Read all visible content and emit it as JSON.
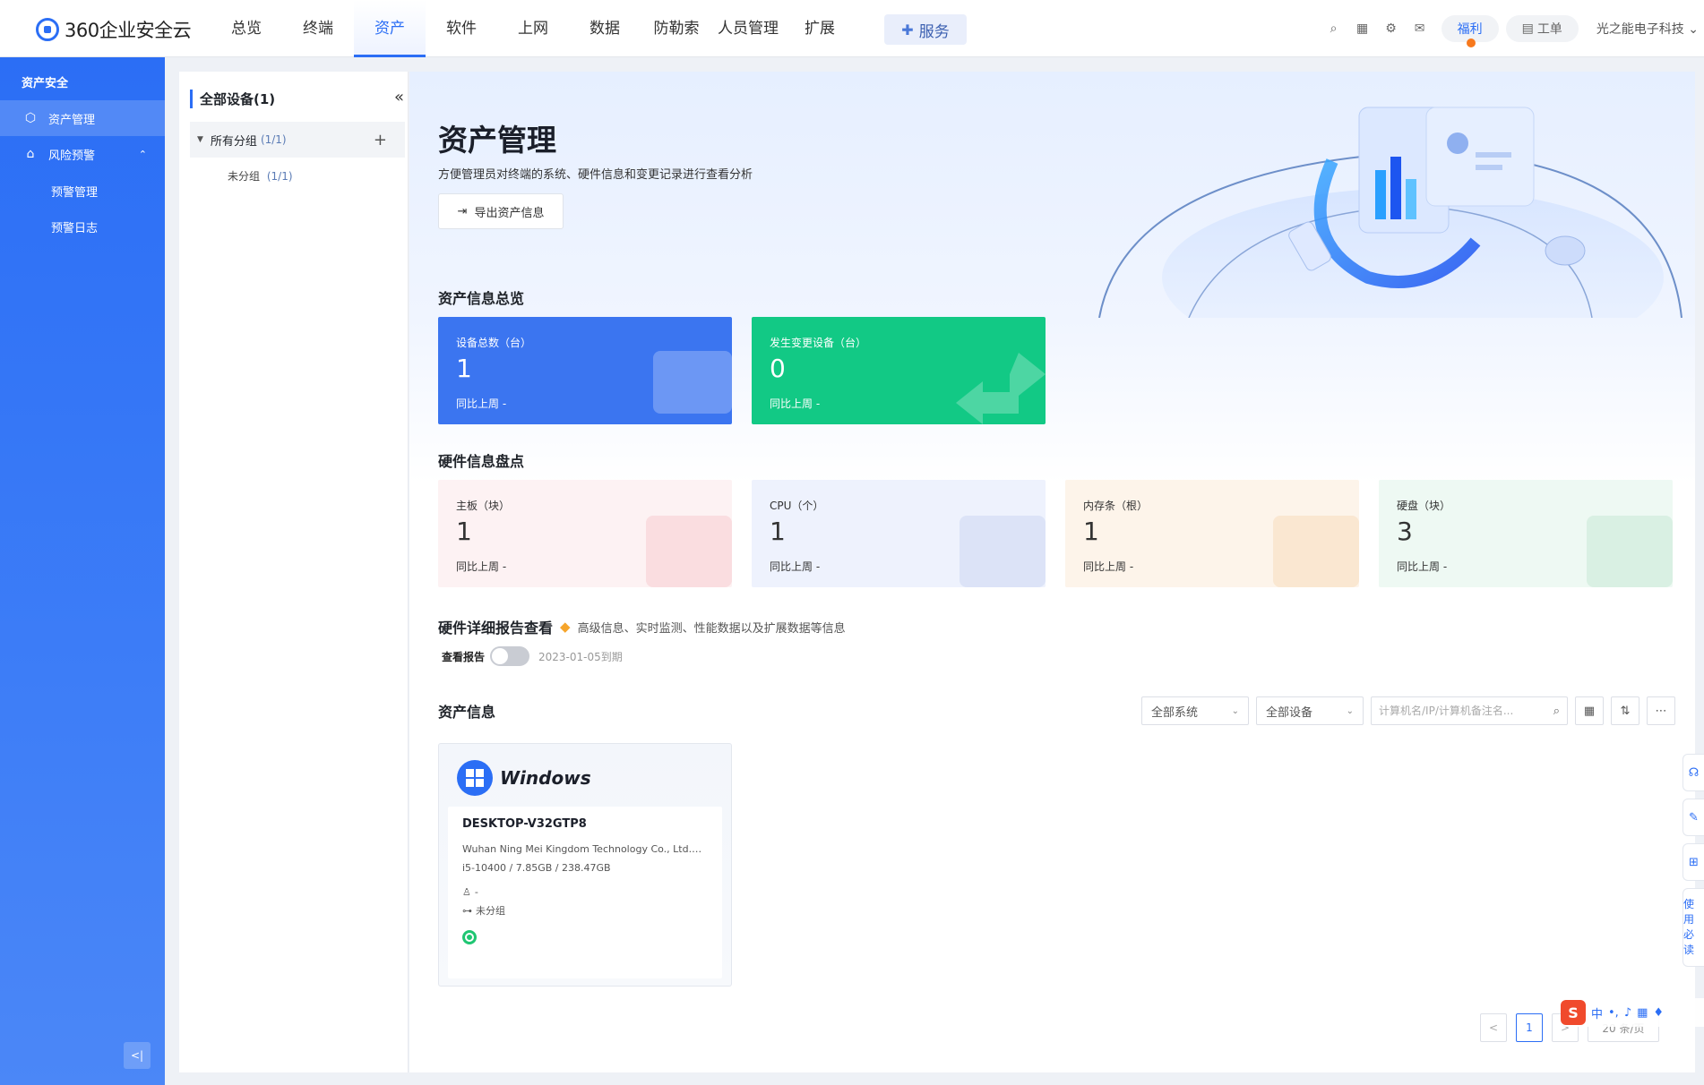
{
  "app": {
    "logo_text": "360企业安全云"
  },
  "nav": {
    "items": [
      {
        "label": "总览"
      },
      {
        "label": "终端"
      },
      {
        "label": "资产"
      },
      {
        "label": "软件"
      },
      {
        "label": "上网"
      },
      {
        "label": "数据"
      },
      {
        "label": "防勒索"
      },
      {
        "label": "人员管理"
      },
      {
        "label": "扩展"
      }
    ],
    "service_label": "服务"
  },
  "topbar": {
    "welfare": "福利",
    "workorder": "工单",
    "user": "光之能电子科技"
  },
  "sidebar": {
    "section": "资产安全",
    "items": [
      {
        "label": "资产管理"
      },
      {
        "label": "风险预警"
      }
    ],
    "sub_items": [
      {
        "label": "预警管理"
      },
      {
        "label": "预警日志"
      }
    ]
  },
  "tree": {
    "title": "全部设备(1)",
    "group": {
      "label": "所有分组",
      "count": "(1/1)"
    },
    "leaf": {
      "label": "未分组",
      "count": "(1/1)"
    }
  },
  "hero": {
    "title": "资产管理",
    "desc": "方便管理员对终端的系统、硬件信息和变更记录进行查看分析",
    "export": "导出资产信息"
  },
  "overview": {
    "title": "资产信息总览",
    "cards": [
      {
        "label": "设备总数（台）",
        "value": "1",
        "compare": "同比上周 -"
      },
      {
        "label": "发生变更设备（台）",
        "value": "0",
        "compare": "同比上周 -"
      }
    ]
  },
  "hardware": {
    "title": "硬件信息盘点",
    "cards": [
      {
        "label": "主板（块）",
        "value": "1",
        "compare": "同比上周 -"
      },
      {
        "label": "CPU（个）",
        "value": "1",
        "compare": "同比上周 -"
      },
      {
        "label": "内存条（根）",
        "value": "1",
        "compare": "同比上周 -"
      },
      {
        "label": "硬盘（块）",
        "value": "3",
        "compare": "同比上周 -"
      }
    ]
  },
  "detail": {
    "title": "硬件详细报告查看",
    "subtitle": "高级信息、实时监测、性能数据以及扩展数据等信息",
    "toggle_label": "查看报告",
    "expiry": "2023-01-05到期"
  },
  "assets": {
    "title": "资产信息",
    "filter_os": "全部系统",
    "filter_device": "全部设备",
    "search_placeholder": "计算机名/IP/计算机备注名...",
    "card": {
      "os": "Windows",
      "name": "DESKTOP-V32GTP8",
      "vendor": "Wuhan Ning Mei Kingdom Technology Co., Ltd.Sy...",
      "specs": "i5-10400 / 7.85GB / 238.47GB",
      "user": "-",
      "group": "未分组"
    }
  },
  "pagination": {
    "current": "1",
    "page_size": "20 条/页"
  },
  "float_tools": {
    "guide": "使用必读"
  },
  "ime": {
    "lang": "中"
  }
}
